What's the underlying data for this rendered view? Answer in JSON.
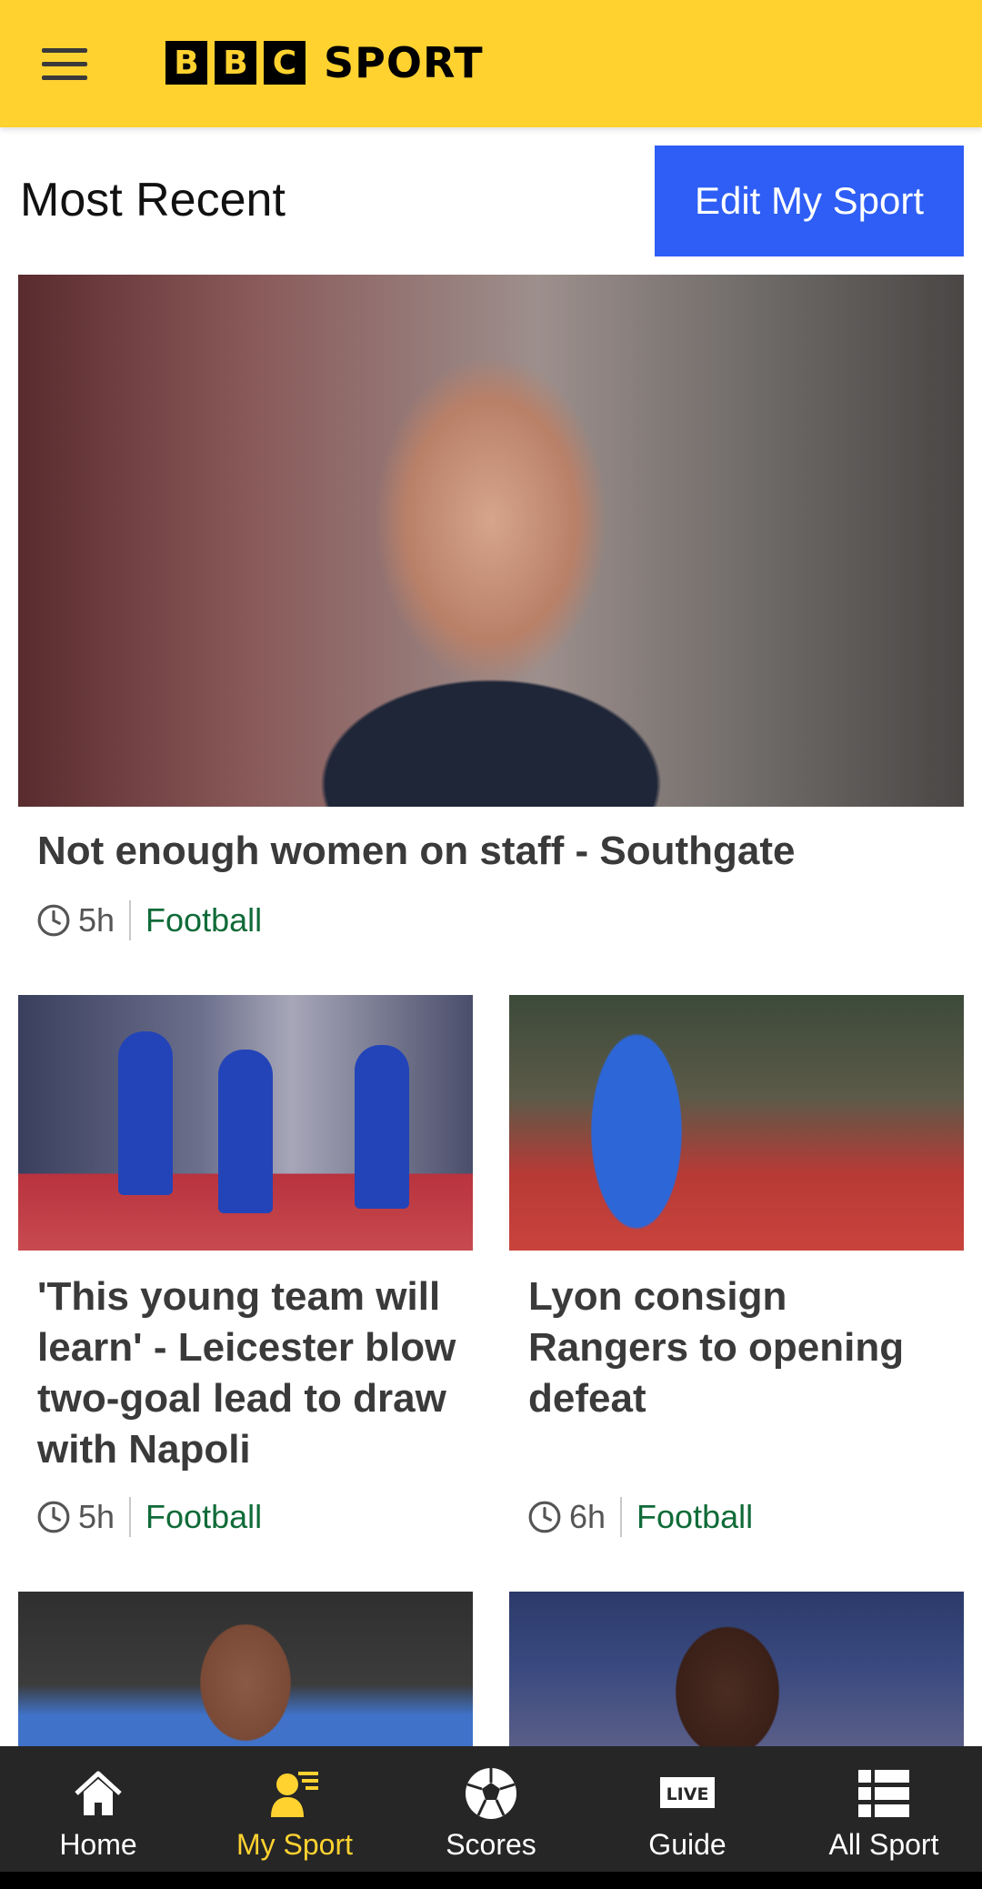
{
  "header": {
    "logo_letters": [
      "B",
      "B",
      "C"
    ],
    "logo_word": "SPORT"
  },
  "section": {
    "title": "Most Recent",
    "edit_button": "Edit My Sport"
  },
  "hero_article": {
    "headline": "Not enough women on staff - Southgate",
    "time": "5h",
    "topic": "Football"
  },
  "articles": [
    {
      "headline": "'This young team will learn' - Leicester blow two-goal lead to draw with Napoli",
      "time": "5h",
      "topic": "Football"
    },
    {
      "headline": "Lyon consign Rangers to opening defeat",
      "time": "6h",
      "topic": "Football"
    }
  ],
  "bottom_nav": {
    "items": [
      {
        "label": "Home",
        "icon": "home-icon",
        "active": false
      },
      {
        "label": "My Sport",
        "icon": "my-sport-icon",
        "active": true
      },
      {
        "label": "Scores",
        "icon": "football-icon",
        "active": false
      },
      {
        "label": "Guide",
        "icon": "live-icon",
        "active": false
      },
      {
        "label": "All Sport",
        "icon": "list-icon",
        "active": false
      }
    ],
    "live_badge": "LIVE"
  },
  "colors": {
    "header_bg": "#ffd230",
    "edit_button_bg": "#2e5ef5",
    "topic_green": "#106b38",
    "nav_bg": "#262626",
    "nav_active": "#ffd230"
  }
}
